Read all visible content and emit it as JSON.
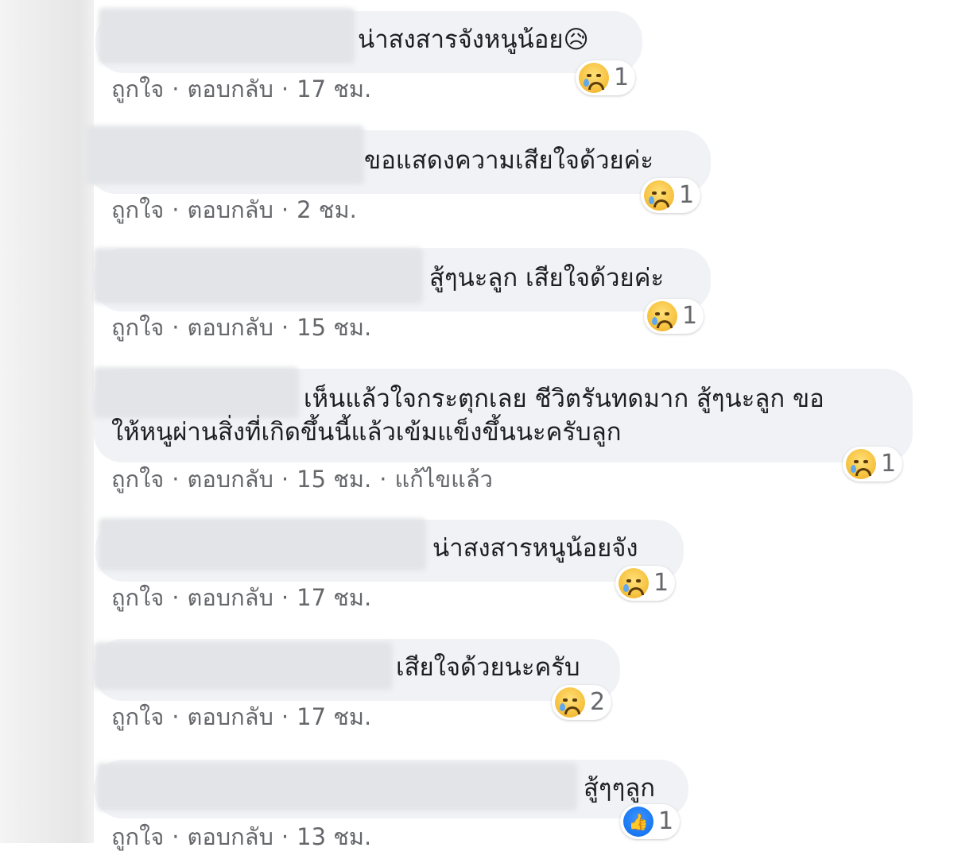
{
  "meta_labels": {
    "like": "ถูกใจ",
    "reply": "ตอบกลับ",
    "separator": "·",
    "edited": "แก้ไขแล้ว"
  },
  "comments": [
    {
      "text": "น่าสงสารจังหนูน้อย😥",
      "time": "17 ชม.",
      "reaction": "sad-icon",
      "count": "1"
    },
    {
      "text": "ขอแสดงความเสียใจด้วยค่ะ",
      "time": "2 ชม.",
      "reaction": "sad-icon",
      "count": "1"
    },
    {
      "text": "สู้ๆนะลูก เสียใจด้วยค่ะ",
      "time": "15 ชม.",
      "reaction": "sad-icon",
      "count": "1"
    },
    {
      "text_line1": "เห็นแล้วใจกระตุกเลย ชีวิตรันทดมาก สู้ๆนะลูก ขอ",
      "text_line2": "ให้หนูผ่านสิ่งที่เกิดขึ้นนี้แล้วเข้มแข็งขึ้นนะครับลูก",
      "time": "15 ชม.",
      "reaction": "sad-icon",
      "count": "1"
    },
    {
      "text": "น่าสงสารหนูน้อยจัง",
      "time": "17 ชม.",
      "reaction": "sad-icon",
      "count": "1"
    },
    {
      "text": "เสียใจด้วยนะครับ",
      "time": "17 ชม.",
      "reaction": "sad-icon",
      "count": "2"
    },
    {
      "text": "สู้ๆๆลูก",
      "time": "13 ชม.",
      "reaction": "like-icon",
      "count": "1"
    }
  ]
}
